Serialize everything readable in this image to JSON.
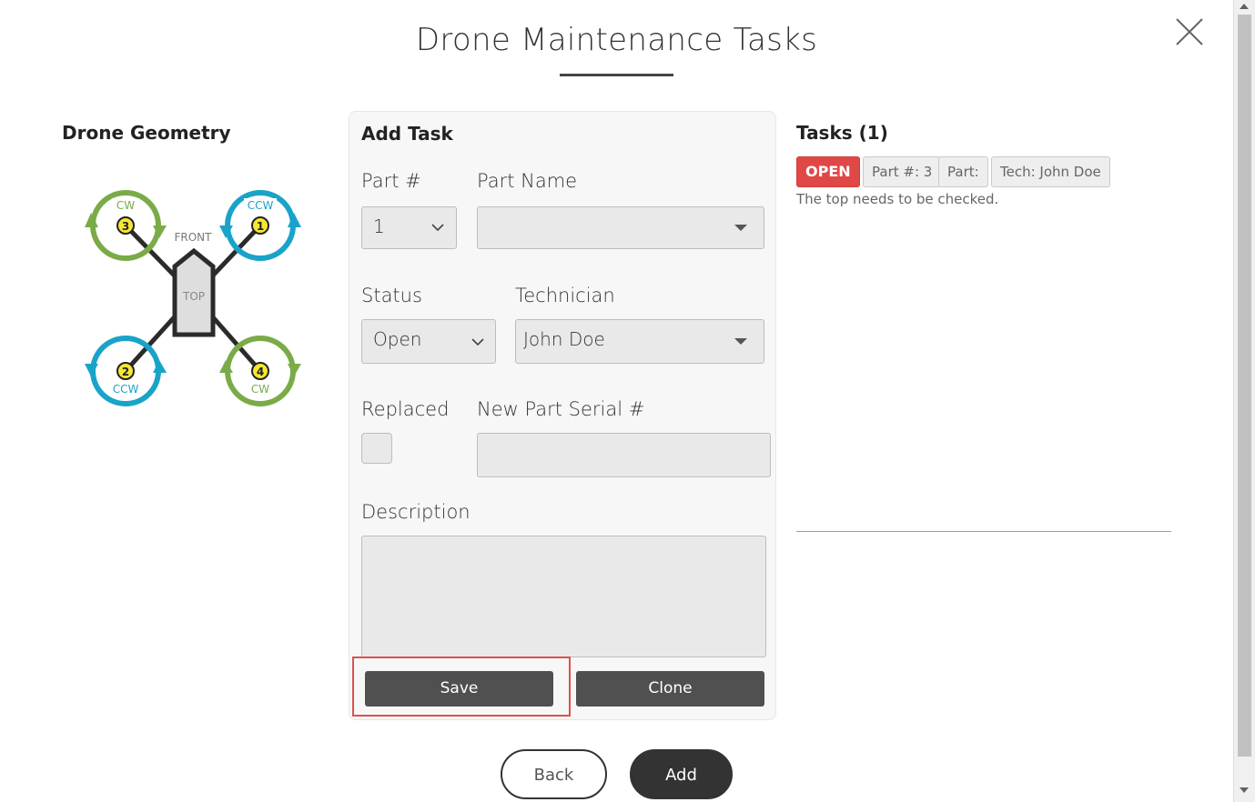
{
  "modal": {
    "title": "Drone Maintenance Tasks",
    "close_icon": "close-icon"
  },
  "geometry": {
    "heading": "Drone Geometry",
    "front_label": "FRONT",
    "top_label": "TOP",
    "rotors": [
      {
        "number": "3",
        "direction": "CW",
        "color": "#7aab48"
      },
      {
        "number": "1",
        "direction": "CCW",
        "color": "#1aa3c8"
      },
      {
        "number": "2",
        "direction": "CCW",
        "color": "#1aa3c8"
      },
      {
        "number": "4",
        "direction": "CW",
        "color": "#7aab48"
      }
    ]
  },
  "form": {
    "heading": "Add Task",
    "part_num_label": "Part #",
    "part_num_value": "1",
    "part_name_label": "Part Name",
    "part_name_value": "",
    "status_label": "Status",
    "status_value": "Open",
    "technician_label": "Technician",
    "technician_value": "John Doe",
    "replaced_label": "Replaced",
    "serial_label": "New Part Serial #",
    "serial_value": "",
    "description_label": "Description",
    "description_value": "",
    "save_label": "Save",
    "clone_label": "Clone"
  },
  "tasks": {
    "heading": "Tasks (1)",
    "items": [
      {
        "status": "OPEN",
        "part_num": "Part #: 3",
        "part": "Part:",
        "tech": "Tech: John Doe",
        "description": "The top needs to be checked."
      }
    ]
  },
  "footer": {
    "back_label": "Back",
    "add_label": "Add"
  },
  "colors": {
    "open_badge": "#e04848",
    "highlight": "#d9534f",
    "dark_button": "#505050"
  }
}
